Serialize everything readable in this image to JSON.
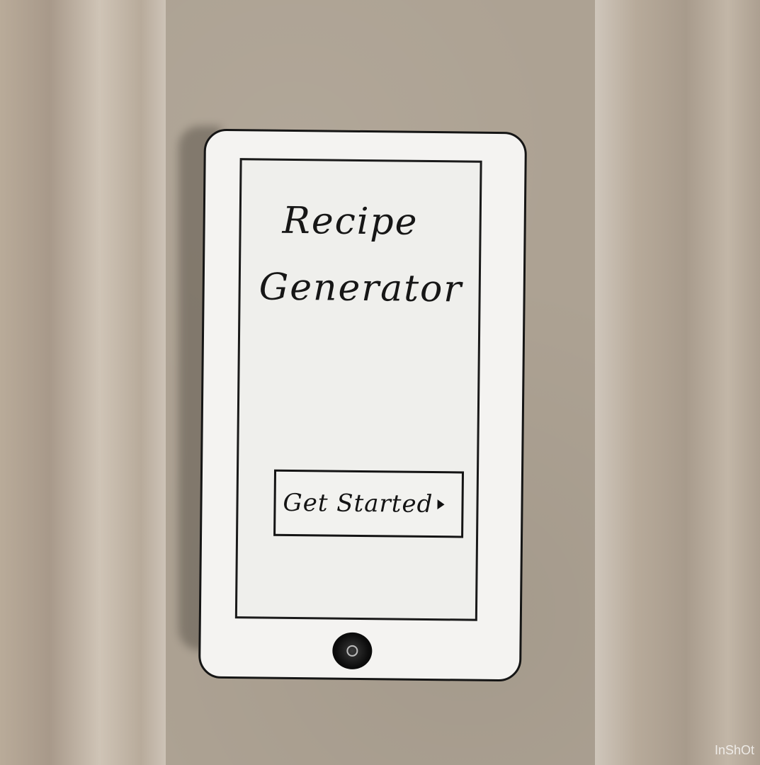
{
  "app": {
    "title_line1": "Recipe",
    "title_line2": "Generator"
  },
  "actions": {
    "get_started_label": "Get Started"
  },
  "icons": {
    "get_started_arrow": "play-arrow-icon",
    "home": "home-button-icon"
  },
  "watermark": "InShOt",
  "colors": {
    "ink": "#141414",
    "paper": "#f4f3f1",
    "cardboard": "#ada293"
  }
}
